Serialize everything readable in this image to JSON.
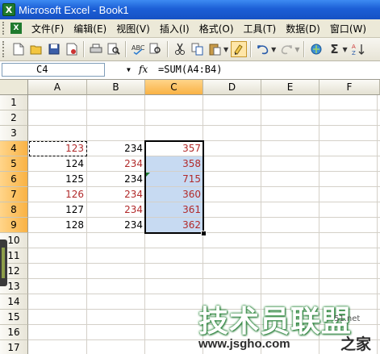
{
  "window": {
    "title": "Microsoft Excel - Book1"
  },
  "menu": {
    "items": [
      "文件(F)",
      "编辑(E)",
      "视图(V)",
      "插入(I)",
      "格式(O)",
      "工具(T)",
      "数据(D)",
      "窗口(W)"
    ]
  },
  "toolbar": {
    "icons": [
      "new-icon",
      "open-icon",
      "save-icon",
      "permission-icon",
      "print-icon",
      "print-preview-icon",
      "spelling-icon",
      "research-icon",
      "cut-icon",
      "copy-icon",
      "paste-icon",
      "format-painter-icon",
      "undo-icon",
      "redo-icon",
      "hyperlink-icon",
      "autosum-icon",
      "sort-ascending-icon"
    ],
    "autosum_glyph": "Σ"
  },
  "formula_bar": {
    "name_box": "C4",
    "fx": "fx",
    "formula": "=SUM(A4:B4)"
  },
  "grid": {
    "columns": [
      "A",
      "B",
      "C",
      "D",
      "E",
      "F"
    ],
    "rows": [
      "1",
      "2",
      "3",
      "4",
      "5",
      "6",
      "7",
      "8",
      "9",
      "10",
      "11",
      "12",
      "13",
      "14",
      "15",
      "16",
      "17"
    ],
    "cells": {
      "A4": "123",
      "B4": "234",
      "C4": "357",
      "A5": "124",
      "B5": "234",
      "C5": "358",
      "A6": "125",
      "B6": "234",
      "C6": "715",
      "A7": "126",
      "B7": "234",
      "C7": "360",
      "A8": "127",
      "B8": "234",
      "C8": "361",
      "A9": "128",
      "B9": "234",
      "C9": "362"
    }
  },
  "watermark": {
    "main": "技术员联盟",
    "url": "www.jsgho.com",
    "tail": "51.net",
    "brand": "之家"
  },
  "colors": {
    "selection": "#c7daf2",
    "header_selected": "#f9b244",
    "title_bar": "#1c5fd6",
    "red_text": "#b12a2a"
  }
}
